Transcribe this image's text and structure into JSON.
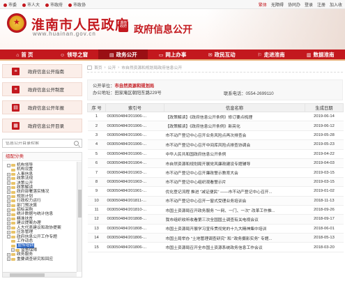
{
  "toplinks": [
    "市委",
    "市人大",
    "市政府",
    "市政协"
  ],
  "toolbar": [
    "繁体",
    "无障碍",
    "协同办",
    "登录",
    "注册",
    "加入收"
  ],
  "header": {
    "site_name": "淮南市人民政府",
    "site_url": "www.huainan.gov.cn",
    "seal_text": "淮南政府",
    "subtitle": "政府信息公开"
  },
  "nav": [
    {
      "icon": "home-icon",
      "label": "首 页"
    },
    {
      "icon": "leader-icon",
      "label": "领导之窗"
    },
    {
      "icon": "open-icon",
      "label": "政务公开"
    },
    {
      "icon": "service-icon",
      "label": "网上办事"
    },
    {
      "icon": "interact-icon",
      "label": "政民互动"
    },
    {
      "icon": "travel-icon",
      "label": "走进淮南"
    },
    {
      "icon": "data-icon",
      "label": "数据淮南"
    }
  ],
  "nav_active_index": 2,
  "sidebar": {
    "buttons": [
      "政府信息公开指南",
      "政府信息公开制度",
      "政府信息公开年报",
      "政府信息公开目录"
    ],
    "search_placeholder": "信息公开目录检索",
    "tree_title": "组配分类",
    "tree": [
      {
        "label": "机构领导",
        "level": 0,
        "toggle": "-"
      },
      {
        "label": "机构设置",
        "level": 1,
        "toggle": ""
      },
      {
        "label": "人事信息",
        "level": 0,
        "toggle": "+"
      },
      {
        "label": "政策法规",
        "level": 0,
        "toggle": "+"
      },
      {
        "label": "决策公开",
        "level": 0,
        "toggle": "+"
      },
      {
        "label": "政策解读",
        "level": 0,
        "toggle": "+"
      },
      {
        "label": "政府部署落实情况",
        "level": 0,
        "toggle": "+"
      },
      {
        "label": "规划计划",
        "level": 0,
        "toggle": "+"
      },
      {
        "label": "行政权力运行",
        "level": 0,
        "toggle": "+"
      },
      {
        "label": "部门预决算",
        "level": 0,
        "toggle": "+"
      },
      {
        "label": "招标采购",
        "level": 0,
        "toggle": "+"
      },
      {
        "label": "统计数据与统计信息",
        "level": 0,
        "toggle": "+"
      },
      {
        "label": "精准扶贫",
        "level": 0,
        "toggle": "+"
      },
      {
        "label": "建议提案办理",
        "level": 0,
        "toggle": "+"
      },
      {
        "label": "人大代表建议和政协提案",
        "level": 0,
        "toggle": "+"
      },
      {
        "label": "应急管理",
        "level": 0,
        "toggle": "+"
      },
      {
        "label": "政府信息公开工作专题",
        "level": 0,
        "toggle": "-"
      },
      {
        "label": "工作动态",
        "level": 1,
        "toggle": ""
      },
      {
        "label": "宣传培训",
        "level": 1,
        "toggle": "",
        "selected": true
      },
      {
        "label": "监督保障",
        "level": 1,
        "toggle": "+"
      },
      {
        "label": "政务服务",
        "level": 0,
        "toggle": "+"
      },
      {
        "label": "重要调查研究和回应",
        "level": 0,
        "toggle": "+"
      }
    ]
  },
  "main": {
    "breadcrumb": [
      "首页",
      "公开",
      "市自然资源和规划局政府信息公开"
    ],
    "unit_label": "公开单位：",
    "unit_value": "市自然资源和规划局",
    "address": "办公地址：田家庵区朝阳东路229号",
    "phone": "联系电话：0554-2699110",
    "columns": [
      "序 号",
      "索引号",
      "信息名称",
      "生成日期"
    ],
    "rows": [
      [
        "1",
        "003050484/201906-...",
        "【政策解读】《政府信息公开条例》修订要点梳理",
        "2019-06-14"
      ],
      [
        "2",
        "003050484/201906-...",
        "【政策解读】《政府信息公开条例》新亮化",
        "2019-06-12"
      ],
      [
        "3",
        "003050484/201906-...",
        "市不动产登记中心召开业务风险点再次排查会",
        "2019-05-28"
      ],
      [
        "4",
        "003050484/201906-...",
        "市不动产登记中心召开中间库风险点排查协调会",
        "2019-05-23"
      ],
      [
        "5",
        "003050484/201906-...",
        "中华人民共和国政府信息公开条例",
        "2019-04-22"
      ],
      [
        "6",
        "003050484/201904-...",
        "市自然资源和规划局开展党风廉政建设专题辅导",
        "2019-04-03"
      ],
      [
        "7",
        "003050484/201903-...",
        "市不动产登记中心召开廉政警示教育大会",
        "2019-03-15"
      ],
      [
        "8",
        "003050484/201903-...",
        "市不动产登记中心组织观看警示片",
        "2019-03-15"
      ],
      [
        "9",
        "003050484/201901-...",
        "优化登记流程 推进 \"减证便民\" ——市不动产登记中心召开...",
        "2019-01-02"
      ],
      [
        "10",
        "003050484/201811-...",
        "市不动产登记中心召开一窗式受理业务培训会",
        "2018-11-13"
      ],
      [
        "11",
        "003050484/201810-...",
        "市国土资源局召开政务服务 \"一网、一门、一次\" 改革工作推...",
        "2018-09-26"
      ],
      [
        "12",
        "003050484/201808-...",
        "我市组织收听收看第三次全国国土调查有关电视会议",
        "2018-09-17"
      ],
      [
        "13",
        "003050484/201808-...",
        "市国土资源局开展学习宣传贯彻党的十九大精神集中培训",
        "2018-06-01"
      ],
      [
        "14",
        "003050484/201806-...",
        "市国土局举办 \"土地管理调查研究\" 和 \"政务摄影实务\" 专题...",
        "2018-05-13"
      ],
      [
        "15",
        "003050484/201806-...",
        "市国土资源局召开全市国土资源系统政务信息工作会议",
        "2018-03-20"
      ]
    ]
  }
}
